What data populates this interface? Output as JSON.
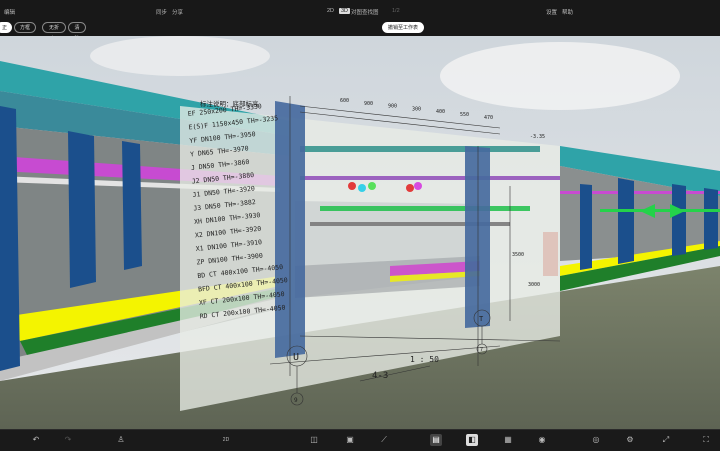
{
  "topbar": {
    "left_label": "编辑",
    "sync_label": "同步",
    "share_label": "分享",
    "view_num": "2D",
    "view_badge": "3D",
    "view_name": "对图查找图",
    "page_indicator": "1/2",
    "settings_label": "设置",
    "help_label": "帮助",
    "tab_front": "正面",
    "tab_plan": "方框",
    "tab_layer": "无折标",
    "tab_clear": "清除",
    "center_pill": "撤销至工作表"
  },
  "drawing": {
    "title": "标注说明：底部标高",
    "pipe_labels": [
      "EF 250x200 TH=-3330",
      "E(S)F 1150x450 TH=-3235",
      "YF DN100 TH=-3950",
      "Y DN65 TH=-3970",
      "J DN50 TH=-3860",
      "J2 DN50 TH=-3880",
      "J1 DN50 TH=-3920",
      "J3 DN50 TH=-3882",
      "XH DN100 TH=-3930",
      "X2 DN100 TH=-3920",
      "X1 DN100 TH=-3910",
      "ZP DN100 TH=-3900",
      "BD CT 400x100 TH=-4050",
      "BFD CT 400x100 TH=-4050",
      "XF CT 200x100 TH=-4050",
      "RD CT 200x100 TH=-4050"
    ],
    "dims_top": [
      "600",
      "900",
      "900",
      "300",
      "400",
      "550",
      "470"
    ],
    "elevation_right": "-3.35",
    "dim_vertical": "3500",
    "elevation_small": "3000",
    "axis_u": "U",
    "axis_u_sub": "9",
    "axis_t": "T",
    "axis_t_sub": "7",
    "section_label": "4-3",
    "scale_label": "1 : 50"
  },
  "bottombar": {
    "undo_icon": "undo-icon",
    "redo_icon": "redo-icon",
    "person_icon": "person-icon",
    "page_label": "2D"
  }
}
